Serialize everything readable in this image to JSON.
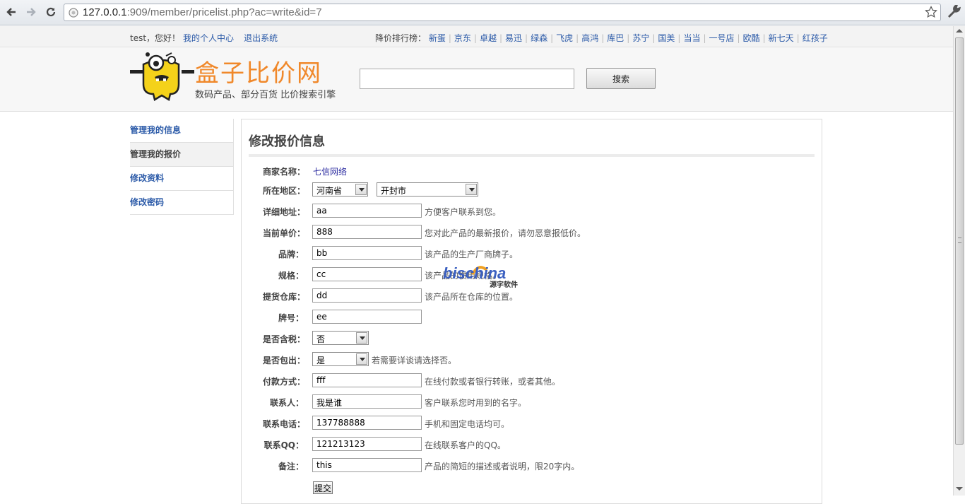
{
  "browser": {
    "url_host": "127.0.0.1",
    "url_rest": ":909/member/pricelist.php?ac=write&id=7"
  },
  "topbar": {
    "greeting": "test，您好！",
    "profile_link": "我的个人中心",
    "logout_link": "退出系统",
    "rank_label": "降价排行榜：",
    "rank_links": [
      "新蛋",
      "京东",
      "卓越",
      "易迅",
      "绿森",
      "飞虎",
      "高鸿",
      "库巴",
      "苏宁",
      "国美",
      "当当",
      "一号店",
      "欧酷",
      "新七天",
      "红孩子"
    ]
  },
  "header": {
    "logo_title": "盒子比价网",
    "logo_subtitle": "数码产品、部分百货 比价搜索引擎",
    "search_value": "",
    "search_button": "搜索"
  },
  "sidebar": {
    "items": [
      {
        "label": "管理我的信息"
      },
      {
        "label": "管理我的报价"
      },
      {
        "label": "修改资料"
      },
      {
        "label": "修改密码"
      }
    ]
  },
  "form": {
    "title": "修改报价信息",
    "merchant_label": "商家名称：",
    "merchant_value": "七信网络",
    "region_label": "所在地区：",
    "province": "河南省",
    "city": "开封市",
    "address_label": "详细地址：",
    "address_value": "aa",
    "address_hint": "方便客户联系到您。",
    "price_label": "当前单价：",
    "price_value": "888",
    "price_hint": "您对此产品的最新报价，请勿恶意报低价。",
    "brand_label": "品牌：",
    "brand_value": "bb",
    "brand_hint": "该产品的生产厂商牌子。",
    "spec_label": "规格：",
    "spec_value": "cc",
    "spec_hint": "该产品的惯用规格。",
    "warehouse_label": "提货仓库：",
    "warehouse_value": "dd",
    "warehouse_hint": "该产品所在仓库的位置。",
    "model_label": "牌号：",
    "model_value": "ee",
    "tax_label": "是否含税：",
    "tax_value": "否",
    "shipping_label": "是否包出：",
    "shipping_value": "是",
    "shipping_hint": "若需要详谈请选择否。",
    "payment_label": "付款方式：",
    "payment_value": "fff",
    "payment_hint": "在线付款或者银行转账，或者其他。",
    "contact_label": "联系人：",
    "contact_value": "我是谁",
    "contact_hint": "客户联系您时用到的名字。",
    "phone_label": "联系电话：",
    "phone_value": "137788888",
    "phone_hint": "手机和固定电话均可。",
    "qq_label": "联系QQ：",
    "qq_value": "121213123",
    "qq_hint": "在线联系客户的QQ。",
    "note_label": "备注：",
    "note_value": "this",
    "note_hint": "产品的简短的描述或者说明，限20字内。",
    "submit_label": "提交"
  },
  "watermark": {
    "brand": "bischina",
    "sub": "源字软件"
  }
}
